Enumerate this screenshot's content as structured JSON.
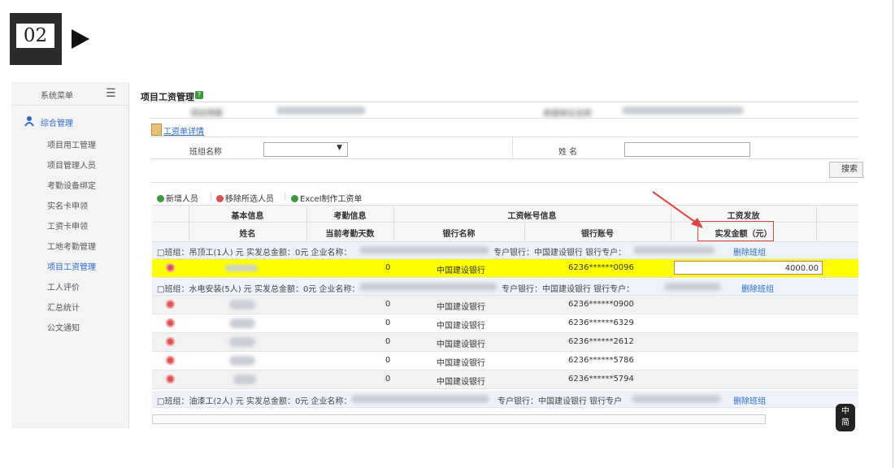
{
  "step": {
    "number": "02"
  },
  "sidebar": {
    "title": "系统菜单",
    "group": "综合管理",
    "items": [
      "项目用工管理",
      "项目管理人员",
      "考勤设备绑定",
      "实名卡申领",
      "工资卡申领",
      "工地考勤管理",
      "项目工资管理",
      "工人评价",
      "汇总统计",
      "公文通知"
    ],
    "active_index": 6
  },
  "main": {
    "title": "项目工资管理",
    "top_labels": {
      "project": "项目预算",
      "unit": "参建单位名称"
    },
    "detail_link": "工资单详情",
    "filter": {
      "team_label": "班组名称",
      "name_label": "姓 名",
      "search_label": "搜索"
    },
    "toolbar": {
      "add": "新增人员",
      "remove": "移除所选人员",
      "excel": "Excel制作工资单"
    },
    "headers": {
      "basic": "基本信息",
      "attendance": "考勤信息",
      "account": "工资帐号信息",
      "pay": "工资发放",
      "name": "姓名",
      "days": "当前考勤天数",
      "bank": "银行名称",
      "bank_no": "银行账号",
      "amount": "实发金额（元）"
    },
    "groups": [
      {
        "text": "□班组：吊顶工(1人) 元  实发总金额：0元  企业名称：",
        "mid": "专户银行：中国建设银行  银行专户：",
        "delete": "删除班组"
      },
      {
        "text": "□班组：水电安装(5人) 元  实发总金额：0元  企业名称：",
        "mid": "专户银行：中国建设银行  银行专户：",
        "delete": "删除班组"
      },
      {
        "text": "□班组：油漆工(2人) 元  实发总金额：0元  企业名称：",
        "mid": "专户银行：中国建设银行  银行专户",
        "delete": "删除班组"
      }
    ],
    "rows": [
      {
        "days": "0",
        "bank": "中国建设银行",
        "account": "6236******0096",
        "amount": "4000.00"
      },
      {
        "days": "0",
        "bank": "中国建设银行",
        "account": "6236******0900"
      },
      {
        "days": "0",
        "bank": "中国建设银行",
        "account": "6236******6329"
      },
      {
        "days": "0",
        "bank": "中国建设银行",
        "account": "6236******2612"
      },
      {
        "days": "0",
        "bank": "中国建设银行",
        "account": "6236******5786"
      },
      {
        "days": "0",
        "bank": "中国建设银行",
        "account": "6236******5794"
      }
    ]
  },
  "ime": {
    "line1": "中",
    "line2": "简"
  },
  "colors": {
    "highlight": "#ffff00",
    "annotation": "#e0443e",
    "link": "#2a6bc5"
  }
}
